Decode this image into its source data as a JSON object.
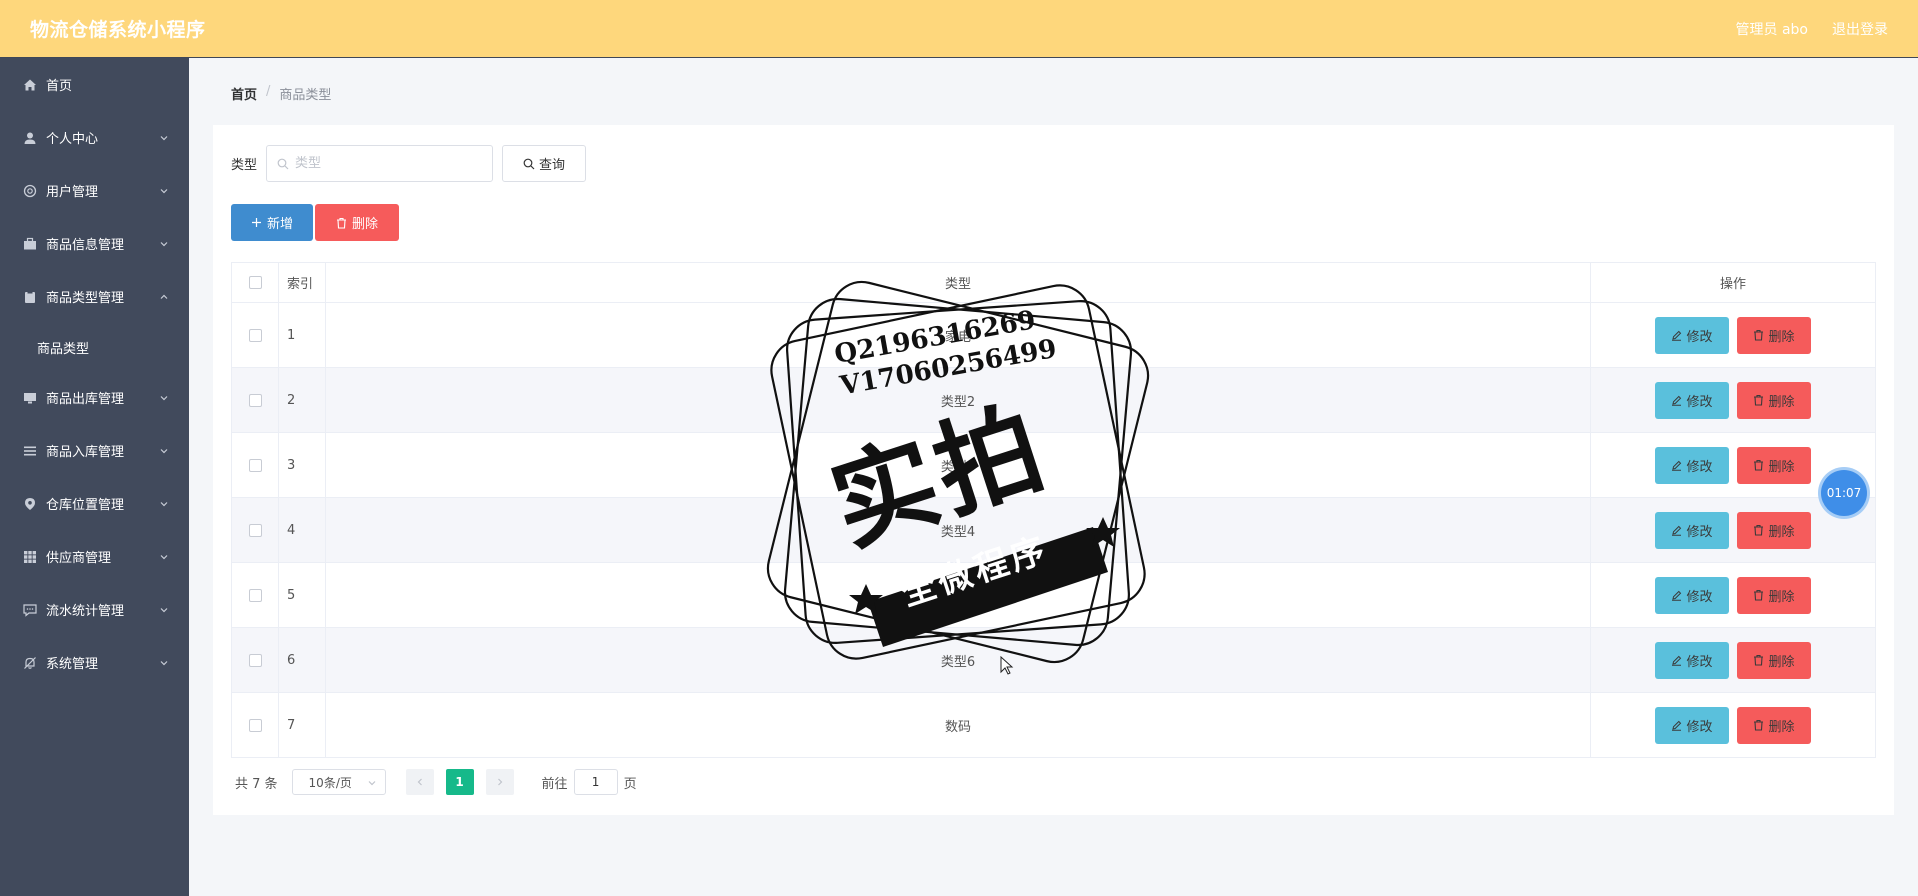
{
  "header": {
    "app_title": "物流仓储系统小程序",
    "user_label": "管理员 abo",
    "logout_label": "退出登录"
  },
  "sidebar": {
    "items": [
      {
        "label": "首页",
        "icon": "home-icon"
      },
      {
        "label": "个人中心",
        "icon": "user-icon"
      },
      {
        "label": "用户管理",
        "icon": "help-icon"
      },
      {
        "label": "商品信息管理",
        "icon": "briefcase-icon"
      },
      {
        "label": "商品类型管理",
        "icon": "clipboard-icon",
        "expanded": true
      },
      {
        "label": "商品出库管理",
        "icon": "monitor-icon"
      },
      {
        "label": "商品入库管理",
        "icon": "list-icon"
      },
      {
        "label": "仓库位置管理",
        "icon": "location-icon"
      },
      {
        "label": "供应商管理",
        "icon": "grid-icon"
      },
      {
        "label": "流水统计管理",
        "icon": "message-icon"
      },
      {
        "label": "系统管理",
        "icon": "bell-off-icon"
      }
    ],
    "submenu": {
      "label": "商品类型"
    }
  },
  "breadcrumb": {
    "home": "首页",
    "separator": "/",
    "current": "商品类型"
  },
  "search": {
    "label": "类型",
    "placeholder": "类型",
    "button_label": "查询"
  },
  "actions": {
    "add_label": "新增",
    "delete_label": "删除"
  },
  "table": {
    "headers": {
      "index": "索引",
      "type": "类型",
      "ops": "操作"
    },
    "edit_label": "修改",
    "delete_label": "删除",
    "rows": [
      {
        "index": "1",
        "type": "家电"
      },
      {
        "index": "2",
        "type": "类型2"
      },
      {
        "index": "3",
        "type": "类型3"
      },
      {
        "index": "4",
        "type": "类型4"
      },
      {
        "index": "5",
        "type": "类型5"
      },
      {
        "index": "6",
        "type": "类型6"
      },
      {
        "index": "7",
        "type": "数码"
      }
    ]
  },
  "pagination": {
    "total_text": "共 7 条",
    "page_size": "10条/页",
    "current_page": "1",
    "goto_prefix": "前往",
    "goto_value": "1",
    "goto_suffix": "页"
  },
  "timer": {
    "value": "01:07"
  },
  "watermark": {
    "line1": "Q2196316269",
    "line2": "V17060256499",
    "big_text": "实拍",
    "ribbon_text": "全微程序"
  },
  "colors": {
    "header_bg": "#fed77c",
    "sidebar_bg": "#414a5c",
    "primary": "#3f8ccf",
    "danger": "#f65b5b",
    "edit": "#5ac0dc",
    "active_page": "#16b98a"
  }
}
